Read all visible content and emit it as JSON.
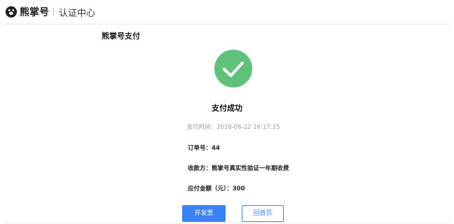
{
  "header": {
    "brand": "熊掌号",
    "subtitle": "认证中心"
  },
  "section_title": "熊掌号支付",
  "status": {
    "title": "支付成功",
    "time_label": "支付时间：",
    "time_value": "2018-06-22 16:17:15",
    "accent_color": "#5ec27a"
  },
  "info": {
    "order_label": "订单号：",
    "order_value": "44",
    "payee_label": "收款方：",
    "payee_value": "熊掌号真实性验证一年期收费",
    "amount_label": "应付金额（元）：",
    "amount_value": "300"
  },
  "actions": {
    "invoice_label": "开发票",
    "home_label": "回首页"
  },
  "icons": {
    "logo": "bear-paw-icon",
    "success": "check-circle-icon"
  }
}
